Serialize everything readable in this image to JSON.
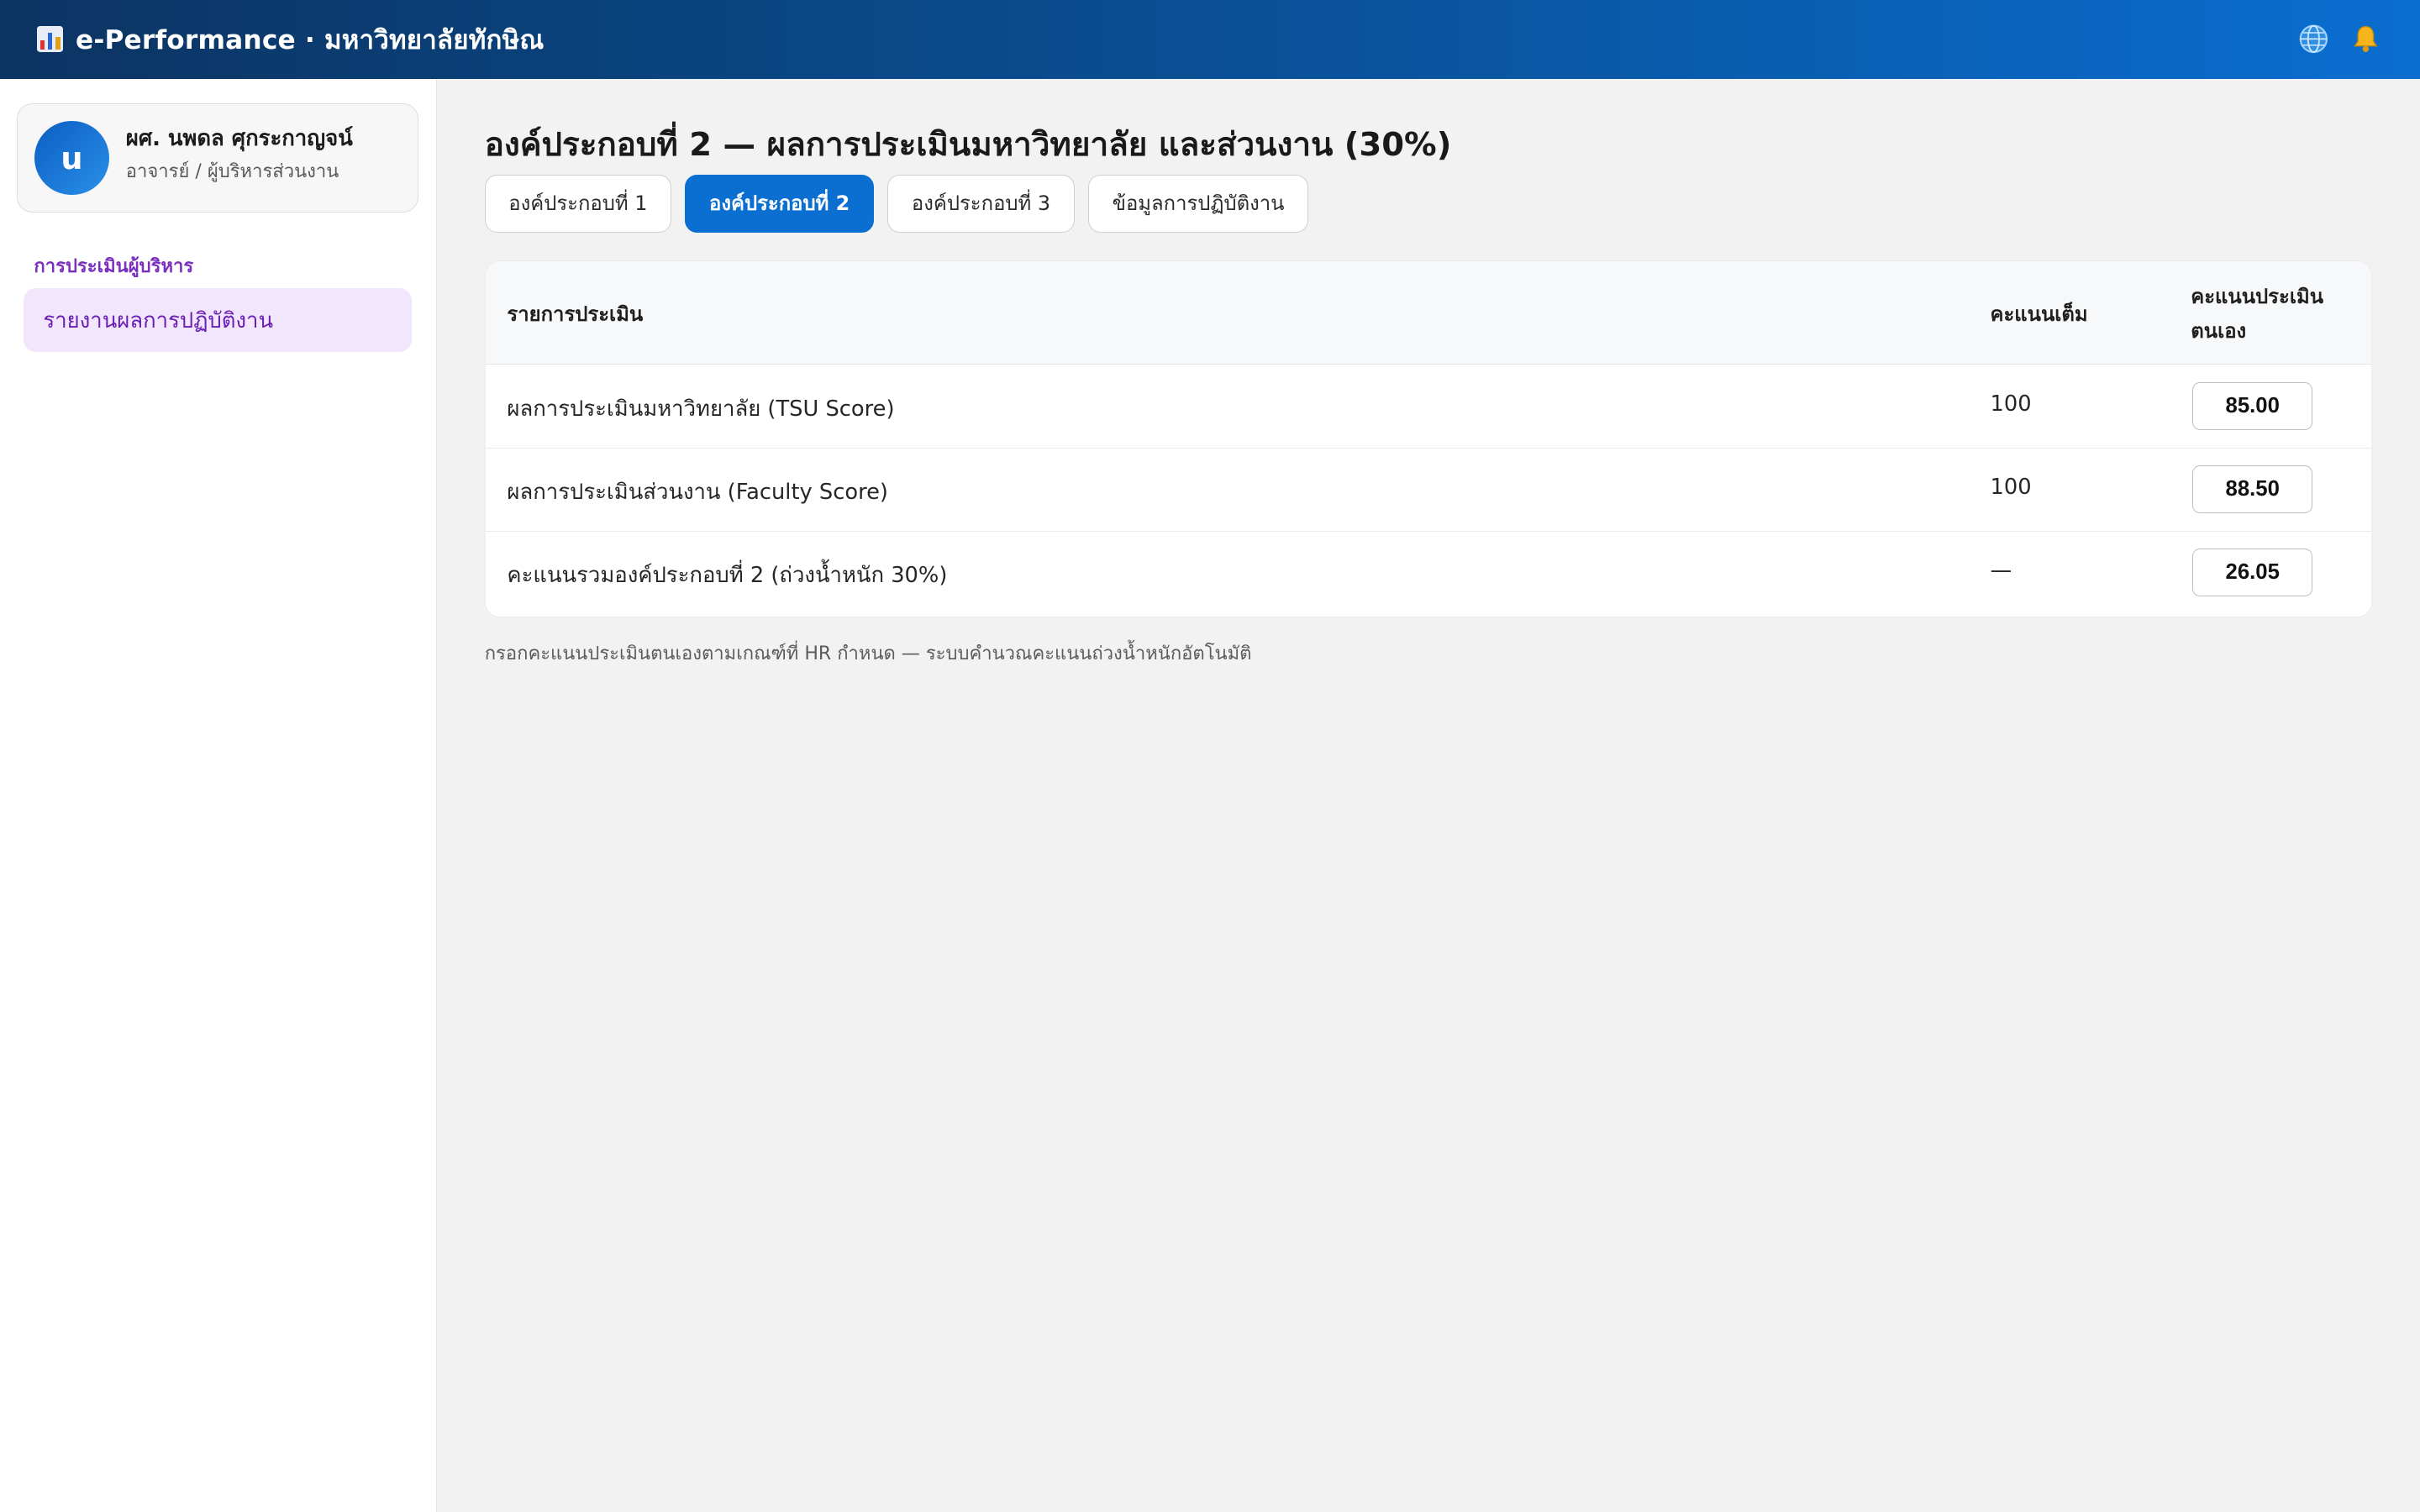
{
  "app": {
    "title": "e-Performance · มหาวิทยาลัยทักษิณ",
    "logo_icon": "bar-chart-icon",
    "globe_icon": "globe-icon",
    "bell_icon": "bell-icon"
  },
  "user": {
    "initial": "u",
    "name": "ผศ. นพดล ศุกระกาญจน์",
    "role": "อาจารย์ / ผู้บริหารส่วนงาน"
  },
  "sidebar": {
    "section": "การประเมินผู้บริหาร",
    "items": [
      {
        "label": "รายงานผลการปฏิบัติงาน",
        "active": true
      }
    ]
  },
  "main": {
    "title": "องค์ประกอบที่ 2 — ผลการประเมินมหาวิทยาลัย และส่วนงาน (30%)",
    "tabs": [
      {
        "label": "องค์ประกอบที่ 1",
        "active": false
      },
      {
        "label": "องค์ประกอบที่ 2",
        "active": true
      },
      {
        "label": "องค์ประกอบที่ 3",
        "active": false
      },
      {
        "label": "ข้อมูลการปฏิบัติงาน",
        "active": false
      }
    ],
    "table": {
      "headers": [
        "รายการประเมิน",
        "คะแนนเต็ม",
        "คะแนนประเมินตนเอง"
      ],
      "rows": [
        {
          "item": "ผลการประเมินมหาวิทยาลัย (TSU Score)",
          "full": "100",
          "self": "85.00"
        },
        {
          "item": "ผลการประเมินส่วนงาน (Faculty Score)",
          "full": "100",
          "self": "88.50"
        },
        {
          "item": "คะแนนรวมองค์ประกอบที่ 2 (ถ่วงน้ำหนัก 30%)",
          "full": "—",
          "self": "26.05"
        }
      ]
    },
    "note": "กรอกคะแนนประเมินตนเองตามเกณฑ์ที่ HR กำหนด — ระบบคำนวณคะแนนถ่วงน้ำหนักอัตโนมัติ"
  },
  "colors": {
    "topbar_start": "#0b3462",
    "topbar_end": "#0a6ed0",
    "tab_active": "#0a6fd0",
    "sidebar_accent": "#7b2fbe",
    "sidebar_active_bg": "#f2e6fd"
  }
}
